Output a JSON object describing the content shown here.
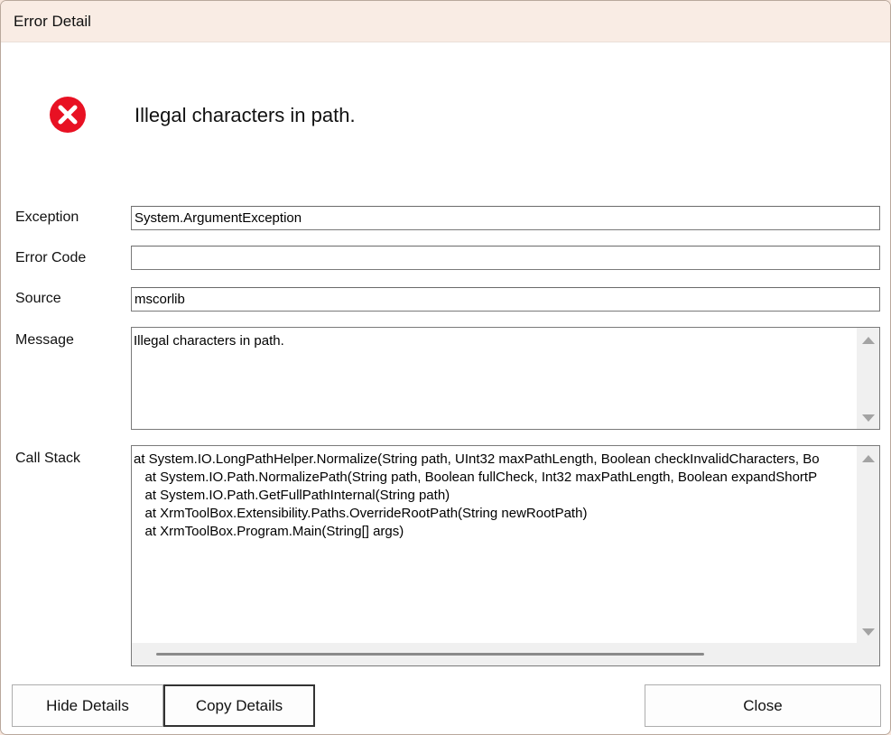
{
  "window": {
    "title": "Error Detail"
  },
  "header": {
    "icon": "error-x-circle-icon",
    "message": "Illegal characters in path."
  },
  "fields": {
    "exception": {
      "label": "Exception",
      "value": "System.ArgumentException"
    },
    "error_code": {
      "label": "Error Code",
      "value": ""
    },
    "source": {
      "label": "Source",
      "value": "mscorlib"
    },
    "message": {
      "label": "Message",
      "value": "Illegal characters in path."
    },
    "call_stack": {
      "label": "Call Stack",
      "value": "at System.IO.LongPathHelper.Normalize(String path, UInt32 maxPathLength, Boolean checkInvalidCharacters, Bo\n   at System.IO.Path.NormalizePath(String path, Boolean fullCheck, Int32 maxPathLength, Boolean expandShortP\n   at System.IO.Path.GetFullPathInternal(String path)\n   at XrmToolBox.Extensibility.Paths.OverrideRootPath(String newRootPath)\n   at XrmToolBox.Program.Main(String[] args)"
    }
  },
  "buttons": {
    "hide_details": "Hide Details",
    "copy_details": "Copy Details",
    "close": "Close"
  },
  "colors": {
    "error_red": "#e81123",
    "focus_border": "#333333"
  }
}
